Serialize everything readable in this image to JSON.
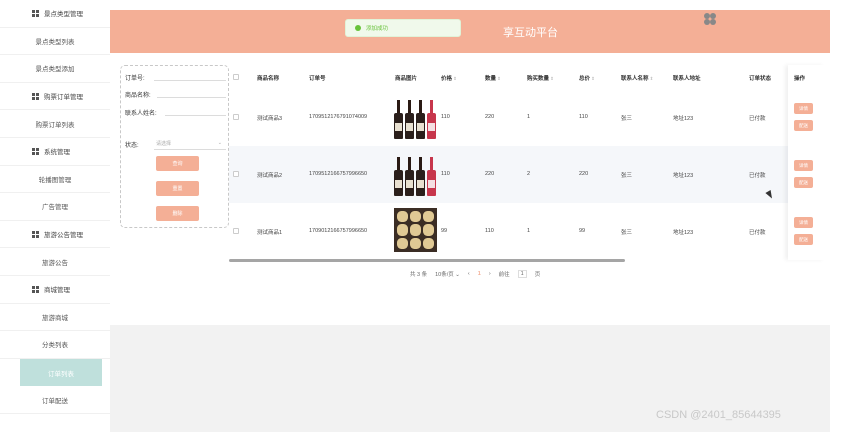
{
  "sidebar": {
    "items": [
      {
        "type": "group",
        "label": "景点类型管理"
      },
      {
        "type": "sub",
        "label": "景点类型列表"
      },
      {
        "type": "sub",
        "label": "景点类型添加"
      },
      {
        "type": "group",
        "label": "购票订单管理"
      },
      {
        "type": "sub",
        "label": "购票订单列表"
      },
      {
        "type": "group",
        "label": "系统管理"
      },
      {
        "type": "sub",
        "label": "轮播图管理"
      },
      {
        "type": "sub",
        "label": "广告管理"
      },
      {
        "type": "group",
        "label": "旅游公告管理"
      },
      {
        "type": "sub",
        "label": "旅游公告"
      },
      {
        "type": "group",
        "label": "商城管理"
      },
      {
        "type": "sub",
        "label": "旅游商城"
      },
      {
        "type": "sub",
        "label": "分类列表"
      },
      {
        "type": "sub",
        "label": "订单列表",
        "active": true
      },
      {
        "type": "sub",
        "label": "订单配送"
      }
    ]
  },
  "header": {
    "title": "享互动平台",
    "toast": "添加成功"
  },
  "search": {
    "order_no_label": "订单号:",
    "product_name_label": "商品名称:",
    "contact_label": "联系人姓名:",
    "status_label": "状态:",
    "status_placeholder": "请选择",
    "query_button": "查询",
    "reset_button": "重置",
    "delete_button": "删除"
  },
  "table": {
    "columns": [
      "商品名称",
      "订单号",
      "商品图片",
      "价格",
      "数量",
      "购买数量",
      "总价",
      "联系人名称",
      "联系人地址",
      "订单状态"
    ],
    "action_header": "操作",
    "rows": [
      {
        "name": "测试商品3",
        "order_no": "1709512176791074009",
        "image": "wine-bottles",
        "price": "110",
        "qty": "220",
        "buy_qty": "1",
        "total": "110",
        "contact": "张三",
        "address": "地址123",
        "status": "已付款"
      },
      {
        "name": "测试商品2",
        "order_no": "1709512166757996650",
        "image": "wine-bottles",
        "price": "110",
        "qty": "220",
        "buy_qty": "2",
        "total": "220",
        "contact": "张三",
        "address": "地址123",
        "status": "已付款"
      },
      {
        "name": "测试商品1",
        "order_no": "1709012166757996650",
        "image": "gift-box",
        "price": "99",
        "qty": "110",
        "buy_qty": "1",
        "total": "99",
        "contact": "张三",
        "address": "地址123",
        "status": "已付款"
      }
    ],
    "detail_button": "详情",
    "ship_button": "配送"
  },
  "pagination": {
    "total": "共 3 条",
    "page_size": "10条/页",
    "current": "1",
    "goto_label": "前往",
    "goto_value": "1",
    "page_unit": "页"
  },
  "watermark": "CSDN @2401_85644395",
  "colors": {
    "accent": "#f4af96",
    "active_menu": "#bfe0dc"
  }
}
